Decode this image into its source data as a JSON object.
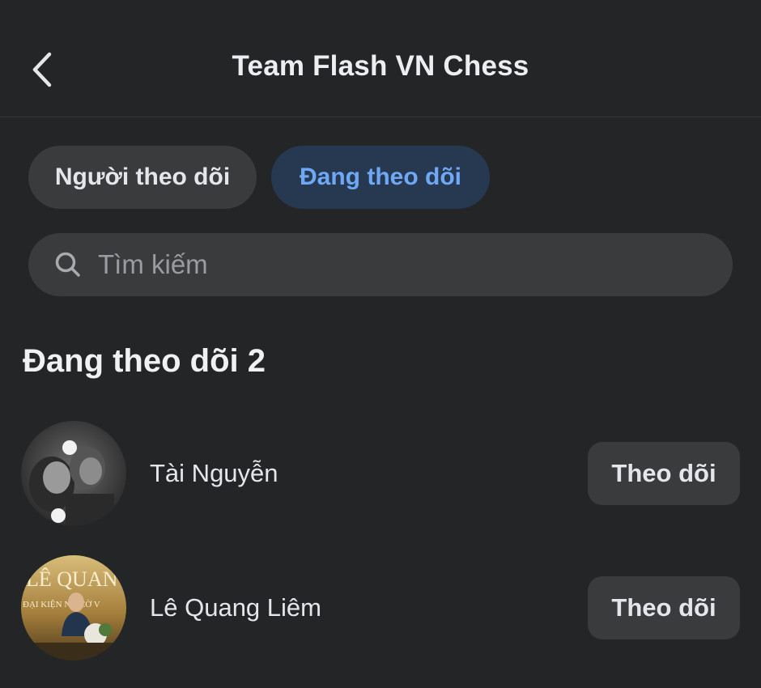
{
  "header": {
    "title": "Team Flash VN Chess",
    "back_icon": "chevron-left-icon"
  },
  "tabs": [
    {
      "label": "Người theo dõi",
      "active": false
    },
    {
      "label": "Đang theo dõi",
      "active": true
    }
  ],
  "search": {
    "placeholder": "Tìm kiếm",
    "value": "",
    "icon": "search-icon"
  },
  "section": {
    "title": "Đang theo dõi 2"
  },
  "people": [
    {
      "name": "Tài Nguyễn",
      "button_label": "Theo dõi",
      "avatar": "avatar-photo-bw"
    },
    {
      "name": "Lê Quang Liêm",
      "button_label": "Theo dõi",
      "avatar": "avatar-photo-event",
      "avatar_text": "LÊ QUAN",
      "avatar_subtext": "ĐẠI KIỆN  NG CỜ V"
    }
  ],
  "colors": {
    "background": "#242526",
    "surface": "#3a3b3c",
    "active_tab_bg": "#263951",
    "active_tab_text": "#6fa8f5"
  }
}
